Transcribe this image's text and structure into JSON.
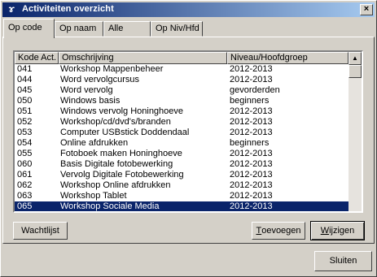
{
  "window": {
    "title": "Activiteiten overzicht"
  },
  "tabs": [
    {
      "label": "Op code",
      "active": true
    },
    {
      "label": "Op naam",
      "active": false
    },
    {
      "label": "Alle",
      "active": false
    },
    {
      "label": "Op Niv/Hfd",
      "active": false
    }
  ],
  "list": {
    "columns": [
      "Kode Act.",
      "Omschrijving",
      "Niveau/Hoofdgroep"
    ],
    "rows": [
      [
        "041",
        "Workshop Mappenbeheer",
        "2012-2013"
      ],
      [
        "044",
        "Word vervolgcursus",
        "2012-2013"
      ],
      [
        "045",
        "Word vervolg",
        "gevorderden"
      ],
      [
        "050",
        "Windows basis",
        "beginners"
      ],
      [
        "051",
        "Windows vervolg Honinghoeve",
        "2012-2013"
      ],
      [
        "052",
        "Workshop/cd/dvd's/branden",
        "2012-2013"
      ],
      [
        "053",
        "Computer USBstick Doddendaal",
        "2012-2013"
      ],
      [
        "054",
        "Online afdrukken",
        "beginners"
      ],
      [
        "055",
        "Fotoboek maken Honinghoeve",
        "2012-2013"
      ],
      [
        "060",
        "Basis Digitale fotobewerking",
        "2012-2013"
      ],
      [
        "061",
        "Vervolg Digitale Fotobewerking",
        "2012-2013"
      ],
      [
        "062",
        "Workshop Online afdrukken",
        "2012-2013"
      ],
      [
        "063",
        "Workshop Tablet",
        "2012-2013"
      ],
      [
        "065",
        "Workshop Sociale Media",
        "2012-2013"
      ]
    ],
    "selected_index": 13
  },
  "buttons": {
    "wachtlijst": "Wachtlijst",
    "toevoegen": {
      "label": "Toevoegen",
      "mnemonic": "T",
      "rest": "oevoegen"
    },
    "wijzigen": {
      "label": "Wijzigen",
      "mnemonic": "W",
      "rest": "ijzigen"
    },
    "sluiten": "Sluiten"
  },
  "icons": {
    "app": "app-icon",
    "close": "close-icon",
    "scroll_up": "scroll-up-icon"
  },
  "colors": {
    "title_start": "#0a246a",
    "title_end": "#a6caf0",
    "selection": "#0a246a",
    "face": "#d4d0c8"
  }
}
